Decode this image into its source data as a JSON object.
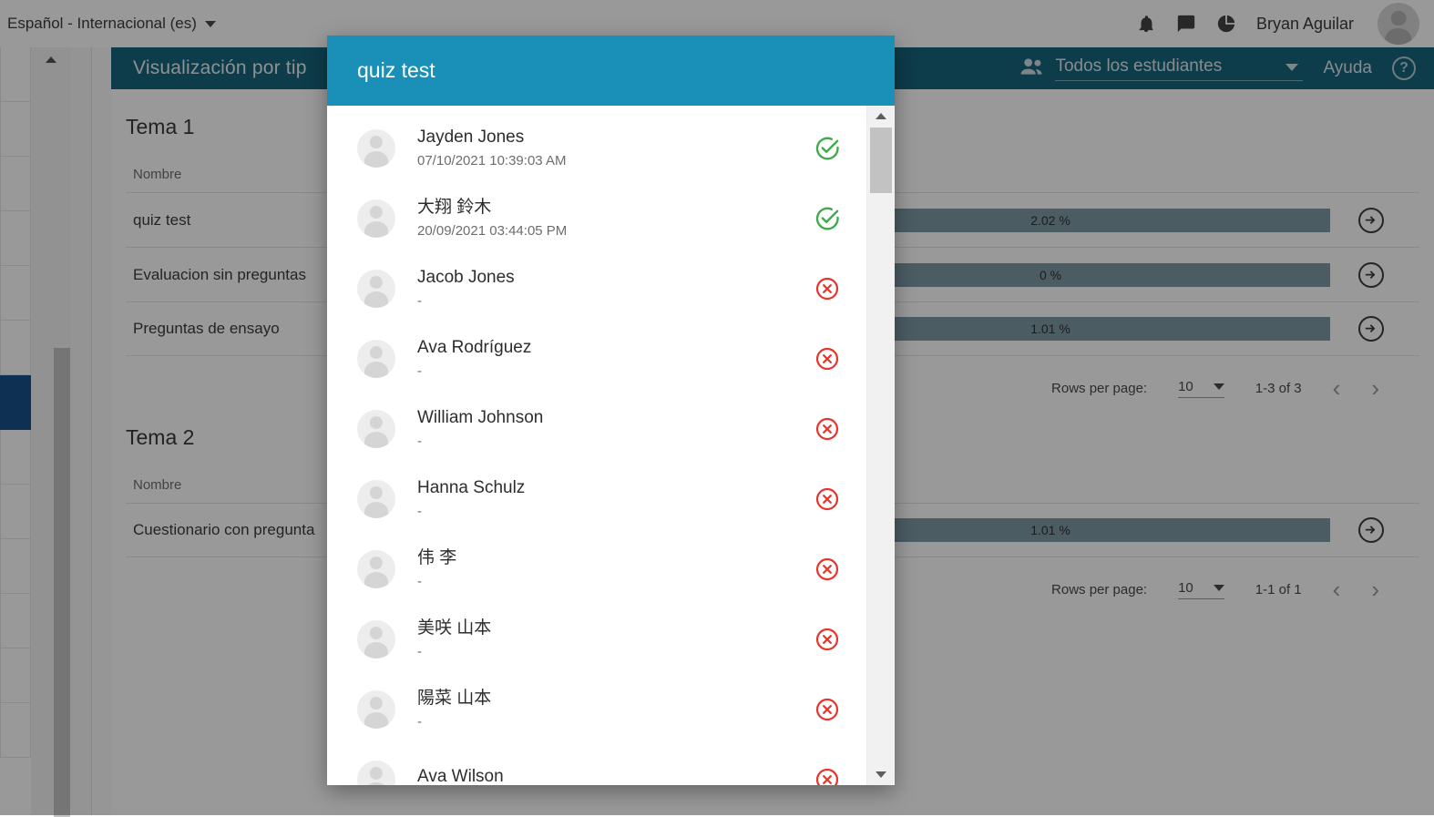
{
  "topbar": {
    "language": "Español - Internacional (es)",
    "user_name": "Bryan Aguilar",
    "icons": [
      "bell-icon",
      "chat-icon",
      "pie-chart-icon"
    ]
  },
  "content_header": {
    "title": "Visualización por tip",
    "student_filter_label": "Todos los estudiantes",
    "help_label": "Ayuda",
    "help_badge": "?"
  },
  "sections": [
    {
      "title": "Tema 1",
      "column_header_name": "Nombre",
      "rows": [
        {
          "name": "quiz test",
          "percent": "2.02 %",
          "bar_fill": 100
        },
        {
          "name": "Evaluacion sin preguntas",
          "percent": "0 %",
          "bar_fill": 100
        },
        {
          "name": "Preguntas de ensayo",
          "percent": "1.01 %",
          "bar_fill": 100
        }
      ],
      "pager": {
        "rows_per_page_label": "Rows per page:",
        "rows_per_page_value": "10",
        "range": "1-3 of 3",
        "prev": "‹",
        "next": "›"
      }
    },
    {
      "title": "Tema 2",
      "column_header_name": "Nombre",
      "rows": [
        {
          "name": "Cuestionario con pregunta",
          "percent": "1.01 %",
          "bar_fill": 100
        }
      ],
      "pager": {
        "rows_per_page_label": "Rows per page:",
        "rows_per_page_value": "10",
        "range": "1-1 of 1",
        "prev": "‹",
        "next": "›"
      }
    }
  ],
  "modal": {
    "title": "quiz test",
    "students": [
      {
        "name": "Jayden Jones",
        "date": "07/10/2021 10:39:03 AM",
        "status": "complete"
      },
      {
        "name": "大翔 鈴木",
        "date": "20/09/2021 03:44:05 PM",
        "status": "complete"
      },
      {
        "name": "Jacob Jones",
        "date": "-",
        "status": "incomplete"
      },
      {
        "name": "Ava Rodríguez",
        "date": "-",
        "status": "incomplete"
      },
      {
        "name": "William Johnson",
        "date": "-",
        "status": "incomplete"
      },
      {
        "name": "Hanna Schulz",
        "date": "-",
        "status": "incomplete"
      },
      {
        "name": "伟 李",
        "date": "-",
        "status": "incomplete"
      },
      {
        "name": "美咲 山本",
        "date": "-",
        "status": "incomplete"
      },
      {
        "name": "陽菜 山本",
        "date": "-",
        "status": "incomplete"
      },
      {
        "name": "Ava Wilson",
        "date": "",
        "status": "incomplete"
      }
    ]
  },
  "colors": {
    "modal_header": "#1a90b9",
    "content_header": "#16647c",
    "bar_fill": "#7e9aa6",
    "status_complete": "#3faa4a",
    "status_incomplete": "#e8342a",
    "sidebar_active": "#17518a"
  }
}
